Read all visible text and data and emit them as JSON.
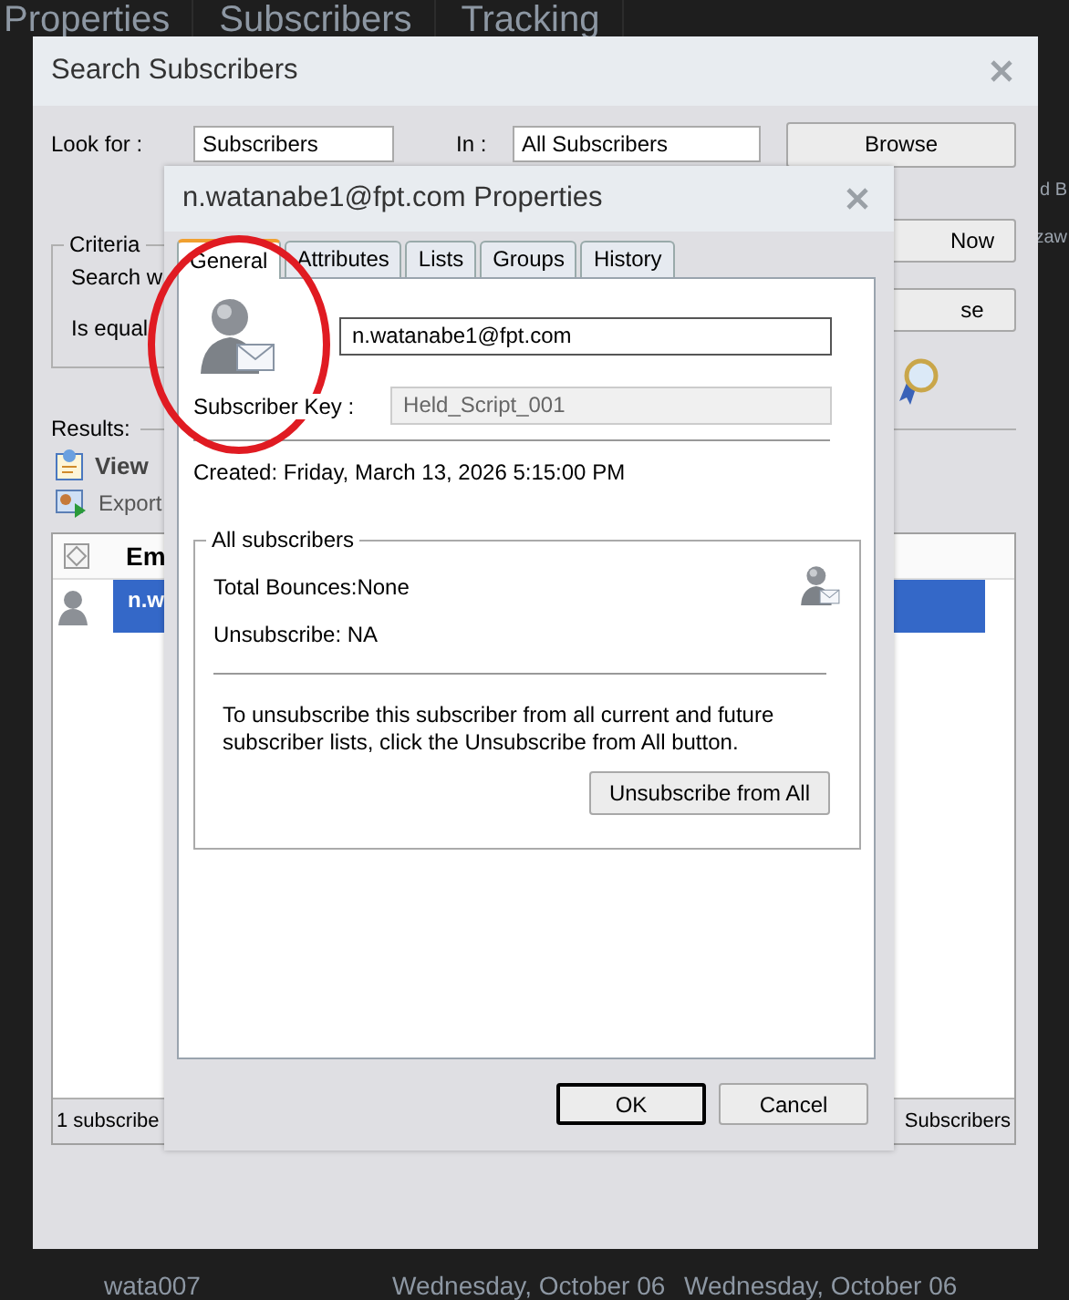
{
  "background_app": {
    "tabs": [
      "Properties",
      "Subscribers",
      "Tracking"
    ],
    "side_fragments": [
      "d B",
      "zaw"
    ],
    "bottom_row": [
      "wata007",
      "Wednesday, October 06",
      "Wednesday, October 06"
    ]
  },
  "search_dialog": {
    "title": "Search Subscribers",
    "look_for": {
      "label": "Look for :",
      "value": "Subscribers"
    },
    "in": {
      "label": "In :",
      "value": "All Subscribers"
    },
    "browse_button": "Browse",
    "criteria": {
      "legend": "Criteria",
      "labels": [
        "Search w",
        "Is equal"
      ]
    },
    "right_buttons": [
      "Now",
      "se"
    ],
    "results_label": "Results:",
    "actions": [
      {
        "kind": "view",
        "label": "View"
      },
      {
        "kind": "export",
        "label": "Export"
      }
    ],
    "table": {
      "columns": [
        "Em"
      ],
      "rows": [
        {
          "cells": [
            "n.w"
          ],
          "selected": true
        }
      ]
    },
    "status_left": "1 subscribe",
    "status_right": "Subscribers"
  },
  "properties_dialog": {
    "title": "n.watanabe1@fpt.com Properties",
    "tabs": [
      {
        "label": "General",
        "selected": true
      },
      {
        "label": "Attributes",
        "selected": false
      },
      {
        "label": "Lists",
        "selected": false
      },
      {
        "label": "Groups",
        "selected": false
      },
      {
        "label": "History",
        "selected": false
      }
    ],
    "email": "n.watanabe1@fpt.com",
    "subscriber_key": {
      "label": "Subscriber Key :",
      "value": "Held_Script_001",
      "disabled": true
    },
    "created": "Created: Friday, March 13, 2026 5:15:00 PM",
    "group": {
      "legend": "All subscribers",
      "total_bounces": "Total Bounces:None",
      "unsubscribe": "Unsubscribe: NA",
      "note": "To unsubscribe this subscriber from all current and future subscriber lists, click the Unsubscribe from All button.",
      "button": "Unsubscribe from All"
    },
    "buttons": [
      {
        "label": "OK",
        "default": true
      },
      {
        "label": "Cancel",
        "default": false
      }
    ]
  }
}
